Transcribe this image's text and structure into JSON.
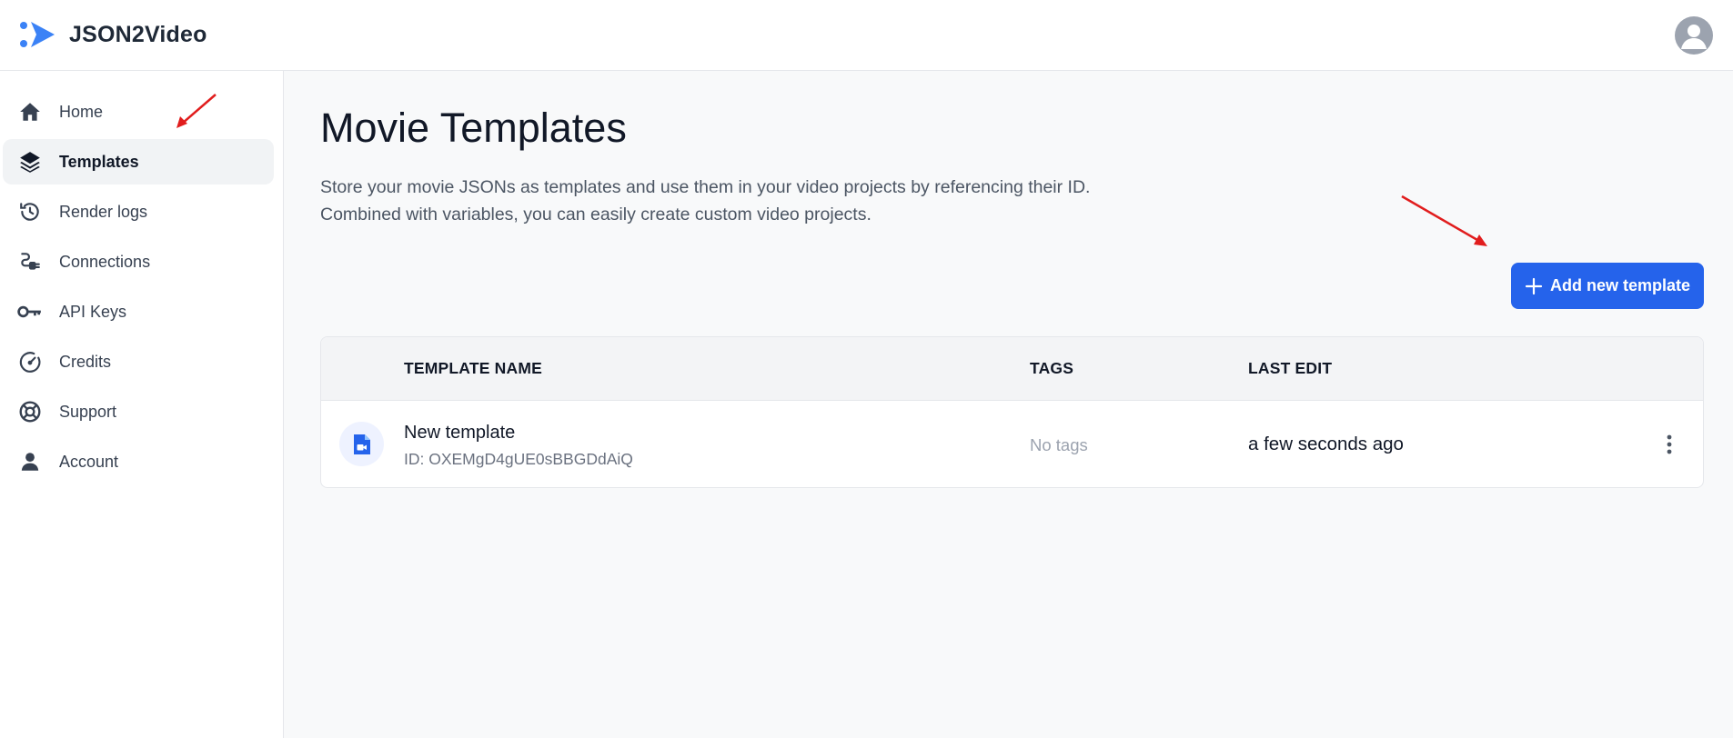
{
  "app": {
    "name": "JSON2Video"
  },
  "sidebar": {
    "items": [
      {
        "label": "Home",
        "icon": "home-icon"
      },
      {
        "label": "Templates",
        "icon": "layers-icon",
        "active": true
      },
      {
        "label": "Render logs",
        "icon": "history-icon"
      },
      {
        "label": "Connections",
        "icon": "plug-icon"
      },
      {
        "label": "API Keys",
        "icon": "key-icon"
      },
      {
        "label": "Credits",
        "icon": "gauge-icon"
      },
      {
        "label": "Support",
        "icon": "lifebuoy-icon"
      },
      {
        "label": "Account",
        "icon": "person-icon"
      }
    ]
  },
  "main": {
    "title": "Movie Templates",
    "description_line1": "Store your movie JSONs as templates and use them in your video projects by referencing their ID.",
    "description_line2": "Combined with variables, you can easily create custom video projects.",
    "add_button_label": "Add new template"
  },
  "table": {
    "headers": {
      "name": "TEMPLATE NAME",
      "tags": "TAGS",
      "last_edit": "LAST EDIT"
    },
    "rows": [
      {
        "name": "New template",
        "id": "ID: OXEMgD4gUE0sBBGDdAiQ",
        "tags": "No tags",
        "last_edit": "a few seconds ago"
      }
    ]
  },
  "colors": {
    "accent": "#2563eb",
    "annotation_arrow": "#e11d1d",
    "logo_blue": "#3b82f6"
  }
}
